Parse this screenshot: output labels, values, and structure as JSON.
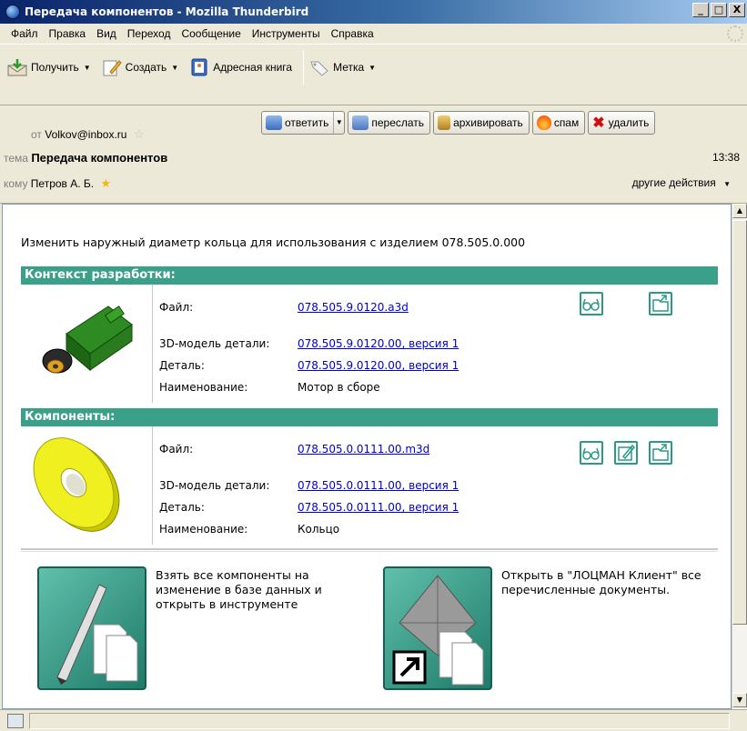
{
  "window": {
    "title": "Передача компонентов - Mozilla Thunderbird",
    "minimize": "_",
    "maximize": "□",
    "close": "X"
  },
  "menu": [
    "Файл",
    "Правка",
    "Вид",
    "Переход",
    "Сообщение",
    "Инструменты",
    "Справка"
  ],
  "toolbar": {
    "get": "Получить",
    "compose": "Создать",
    "address_book": "Адресная книга",
    "tag": "Метка"
  },
  "header": {
    "from_label": "от",
    "from_value": "Volkov@inbox.ru",
    "subject_label": "тема",
    "subject_value": "Передача компонентов",
    "time": "13:38",
    "to_label": "кому",
    "to_value": "Петров А. Б.",
    "more_actions": "другие действия",
    "buttons": {
      "reply": "ответить",
      "forward": "переслать",
      "archive": "архивировать",
      "spam": "спам",
      "delete": "удалить"
    }
  },
  "message": {
    "intro": "Изменить наружный диаметр кольца для использования с изделием 078.505.0.000",
    "context": {
      "title": "Контекст разработки:",
      "file_label": "Файл:",
      "file_value": "078.505.9.0120.a3d",
      "model_label": "3D-модель детали:",
      "model_value": "078.505.9.0120.00, версия 1",
      "part_label": "Деталь:",
      "part_value": "078.505.9.0120.00, версия 1",
      "name_label": "Наименование:",
      "name_value": "Мотор в сборе"
    },
    "components": {
      "title": "Компоненты:",
      "file_label": "Файл:",
      "file_value": "078.505.0.0111.00.m3d",
      "model_label": "3D-модель детали:",
      "model_value": "078.505.0.0111.00, версия 1",
      "part_label": "Деталь:",
      "part_value": "078.505.0.0111.00, версия 1",
      "name_label": "Наименование:",
      "name_value": "Кольцо"
    },
    "take_text": "Взять все компоненты на изменение в базе данных и открыть в инструменте",
    "open_text": "Открыть в \"ЛОЦМАН Клиент\" все перечисленные документы."
  },
  "colors": {
    "section_header": "#3aa08a",
    "link": "#0000cc",
    "title_bar": "#0a246a"
  }
}
